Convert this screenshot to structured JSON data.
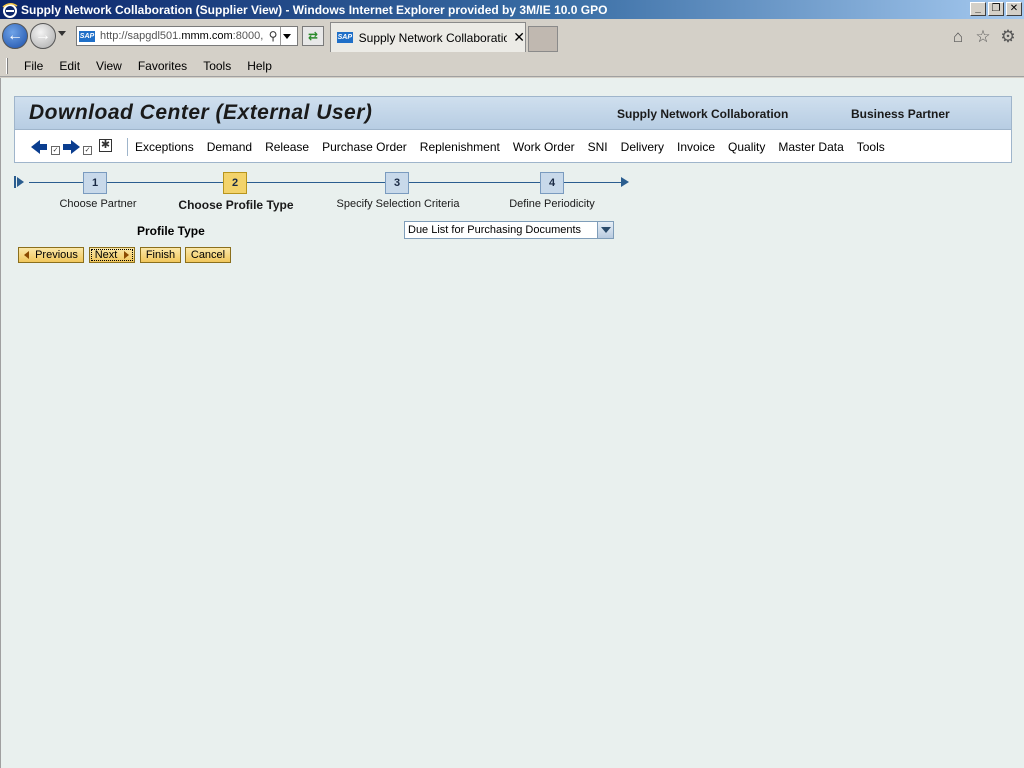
{
  "window": {
    "title": "Supply Network Collaboration (Supplier View) - Windows Internet Explorer provided by 3M/IE 10.0 GPO"
  },
  "browser": {
    "url_prefix": "http://sapgdl501.",
    "url_domain": "mmm.com",
    "url_suffix": ":8000,",
    "tab_title": "Supply Network Collaboratio...",
    "tab_close": "✕"
  },
  "menubar": {
    "items": [
      "File",
      "Edit",
      "View",
      "Favorites",
      "Tools",
      "Help"
    ]
  },
  "header": {
    "title": "Download Center (External User)",
    "links": [
      "Supply Network Collaboration",
      "Business Partner"
    ]
  },
  "toolbar": {
    "nav_items": [
      "Exceptions",
      "Demand",
      "Release",
      "Purchase Order",
      "Replenishment",
      "Work Order",
      "SNI",
      "Delivery",
      "Invoice",
      "Quality",
      "Master Data",
      "Tools"
    ]
  },
  "roadmap": {
    "steps": [
      {
        "number": "1",
        "label": "Choose Partner"
      },
      {
        "number": "2",
        "label": "Choose Profile Type"
      },
      {
        "number": "3",
        "label": "Specify Selection Criteria"
      },
      {
        "number": "4",
        "label": "Define Periodicity"
      }
    ],
    "active_step": 2
  },
  "form": {
    "profile_type_label": "Profile Type",
    "profile_type_value": "Due List for Purchasing Documents"
  },
  "buttons": {
    "previous": "Previous",
    "next": "Next",
    "finish": "Finish",
    "cancel": "Cancel"
  },
  "colors": {
    "content_bg": "#e9f0ee",
    "header_bg": "#b7cde3",
    "active_step": "#f3d36a",
    "button": "#f1c75c"
  }
}
